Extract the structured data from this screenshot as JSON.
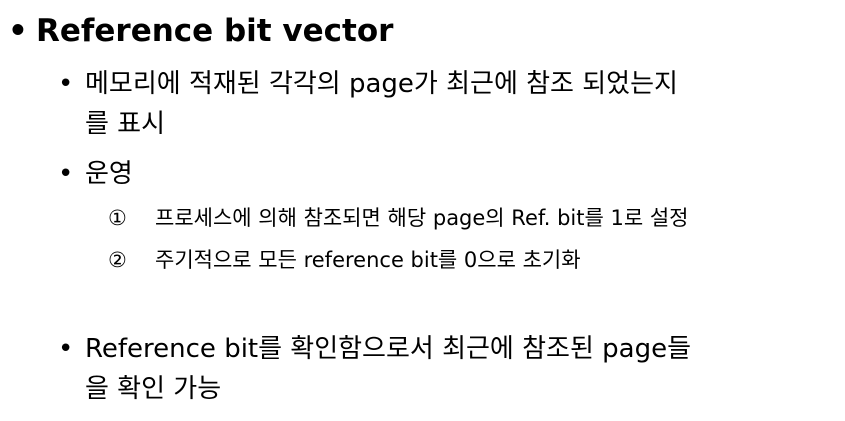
{
  "title": "Reference bit vector",
  "bullets": [
    {
      "line1": "메모리에 적재된 각각의 page가 최근에 참조 되었는지",
      "line2": "를 표시"
    },
    {
      "line1": "운영"
    },
    {
      "line1": "Reference bit를 확인함으로서 최근에 참조된 page들",
      "line2": "을 확인 가능"
    }
  ],
  "steps": [
    {
      "marker": "①",
      "text": "프로세스에 의해 참조되면 해당 page의 Ref. bit를 1로 설정"
    },
    {
      "marker": "②",
      "text": "주기적으로 모든 reference bit를 0으로 초기화"
    }
  ],
  "bullet_char": "•"
}
